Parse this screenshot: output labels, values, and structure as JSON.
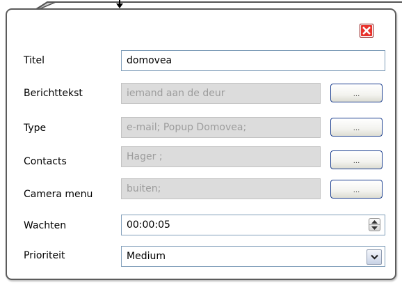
{
  "dialog": {
    "fields": [
      {
        "label": "Titel",
        "value": "domovea"
      },
      {
        "label": "Berichttekst",
        "value": "iemand aan de deur",
        "button_label": "..."
      },
      {
        "label": "Type",
        "value": "e-mail; Popup Domovea;",
        "button_label": "..."
      },
      {
        "label": "Contacts",
        "value": "Hager  ;",
        "button_label": "..."
      },
      {
        "label": "Camera menu",
        "value": "buiten;",
        "button_label": "..."
      },
      {
        "label": "Wachten",
        "value": "00:00:05"
      },
      {
        "label": "Prioriteit",
        "value": "Medium"
      }
    ]
  },
  "icons": {
    "close": "close-icon",
    "spin_up": "spin-up-icon",
    "spin_down": "spin-down-icon",
    "dropdown": "chevron-down-icon"
  },
  "colors": {
    "close_button": "#e8322c",
    "browse_button_border": "#1c3f8f",
    "disabled_field_bg": "#dcdcdc",
    "field_border": "#7f9db9"
  }
}
